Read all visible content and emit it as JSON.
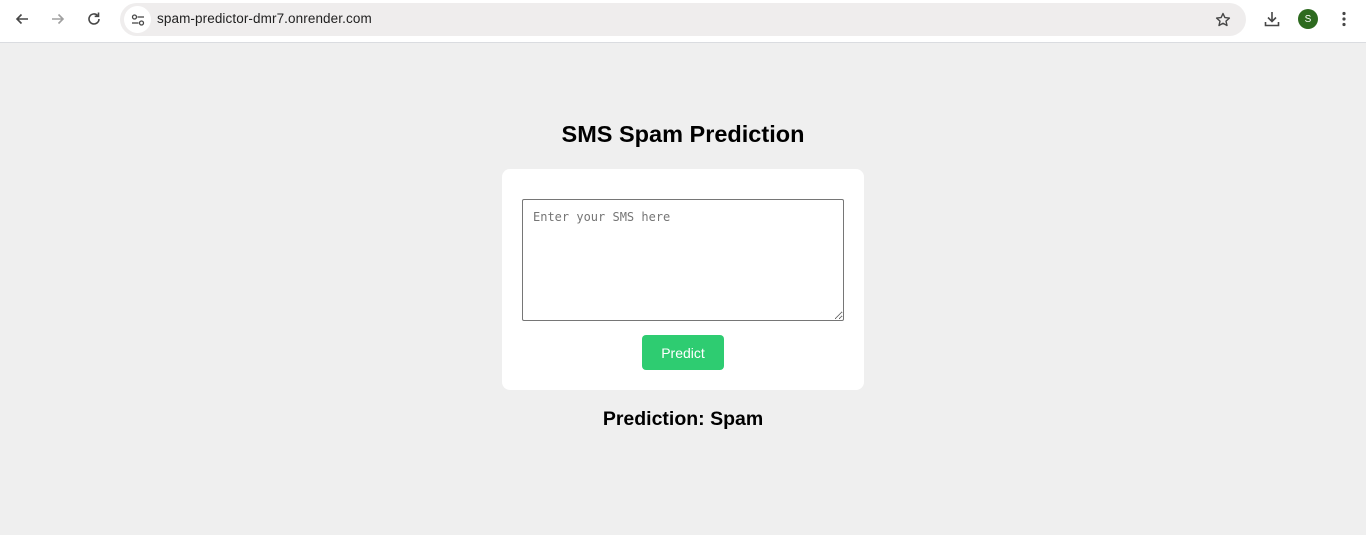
{
  "browser": {
    "url": "spam-predictor-dmr7.onrender.com",
    "avatar_initial": "S",
    "icons": {
      "back": "arrow-left-icon",
      "forward": "arrow-right-icon",
      "reload": "reload-icon",
      "site_info": "tune-icon",
      "bookmark": "star-icon",
      "download": "download-icon",
      "menu": "more-vertical-icon"
    }
  },
  "page": {
    "title": "SMS Spam Prediction",
    "input_placeholder": "Enter your SMS here",
    "input_value": "",
    "predict_label": "Predict",
    "prediction_text": "Prediction: Spam"
  },
  "colors": {
    "background": "#efefef",
    "card": "#ffffff",
    "button": "#2ecc71",
    "avatar": "#2d6a1f"
  }
}
